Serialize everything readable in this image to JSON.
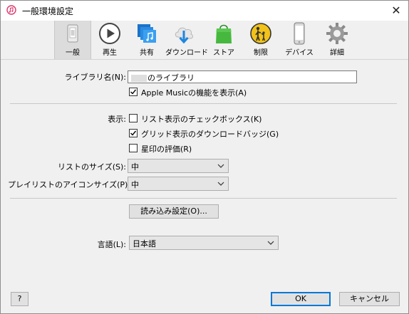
{
  "window": {
    "title": "一般環境設定",
    "close_glyph": "✕"
  },
  "toolbar": {
    "items": [
      {
        "label": "一般",
        "icon": "general-icon",
        "selected": true
      },
      {
        "label": "再生",
        "icon": "playback-icon",
        "selected": false
      },
      {
        "label": "共有",
        "icon": "sharing-icon",
        "selected": false
      },
      {
        "label": "ダウンロード",
        "icon": "download-icon",
        "selected": false
      },
      {
        "label": "ストア",
        "icon": "store-icon",
        "selected": false
      },
      {
        "label": "制限",
        "icon": "restrictions-icon",
        "selected": false
      },
      {
        "label": "デバイス",
        "icon": "devices-icon",
        "selected": false
      },
      {
        "label": "詳細",
        "icon": "advanced-gear-icon",
        "selected": false
      }
    ]
  },
  "library": {
    "label": "ライブラリ名(N):",
    "value_suffix": "のライブラリ",
    "apple_music_checkbox": {
      "label": "Apple Musicの機能を表示(A)",
      "checked": true
    }
  },
  "display": {
    "label": "表示:",
    "options": [
      {
        "label": "リスト表示のチェックボックス(K)",
        "checked": false
      },
      {
        "label": "グリッド表示のダウンロードバッジ(G)",
        "checked": true
      },
      {
        "label": "星印の評価(R)",
        "checked": false
      }
    ]
  },
  "list_size": {
    "label": "リストのサイズ(S):",
    "value": "中"
  },
  "playlist_icon_size": {
    "label": "プレイリストのアイコンサイズ(P):",
    "value": "中"
  },
  "import_settings_button": "読み込み設定(O)...",
  "language": {
    "label": "言語(L):",
    "value": "日本語"
  },
  "footer": {
    "help_label": "?",
    "ok_label": "OK",
    "cancel_label": "キャンセル"
  },
  "colors": {
    "accent": "#0078d7",
    "window_bg": "#f0f0f0"
  }
}
